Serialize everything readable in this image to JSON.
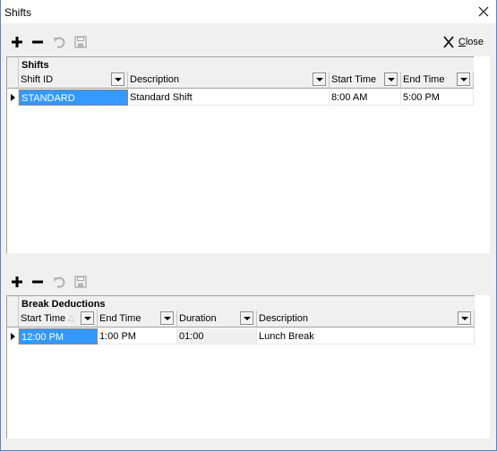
{
  "window": {
    "title": "Shifts",
    "close_icon": "close-x-icon"
  },
  "top_toolbar": {
    "add_icon": "plus-icon",
    "remove_icon": "minus-icon",
    "undo_icon": "undo-icon",
    "save_icon": "save-disk-icon",
    "close_label_prefix": "",
    "close_label_accel": "C",
    "close_label_rest": "lose"
  },
  "shifts_grid": {
    "band_title": "Shifts",
    "columns": [
      {
        "label": "Shift ID"
      },
      {
        "label": "Description"
      },
      {
        "label": "Start Time"
      },
      {
        "label": "End Time"
      }
    ],
    "rows": [
      {
        "shift_id": "STANDARD",
        "description": "Standard Shift",
        "start_time": "8:00 AM",
        "end_time": "5:00 PM"
      }
    ]
  },
  "bottom_toolbar": {
    "add_icon": "plus-icon",
    "remove_icon": "minus-icon",
    "undo_icon": "undo-icon",
    "save_icon": "save-disk-icon"
  },
  "breaks_grid": {
    "band_title": "Break Deductions",
    "columns": [
      {
        "label": "Start Time",
        "sort": "ascending"
      },
      {
        "label": "End Time"
      },
      {
        "label": "Duration"
      },
      {
        "label": "Description"
      }
    ],
    "rows": [
      {
        "start_time": "12:00 PM",
        "end_time": "1:00 PM",
        "duration": "01:00",
        "description": "Lunch Break"
      }
    ]
  }
}
